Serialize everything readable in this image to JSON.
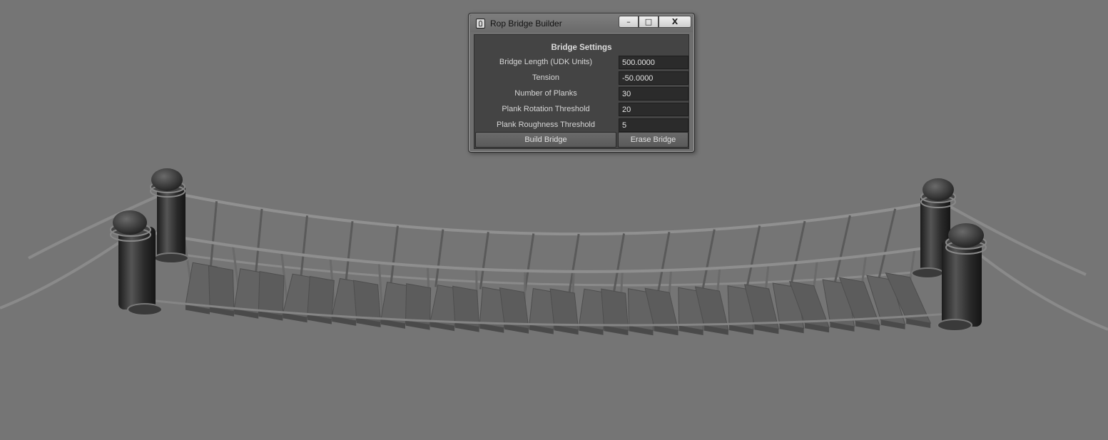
{
  "window": {
    "title": "Rop Bridge Builder",
    "controls": {
      "minimize": "–",
      "maximize": "□",
      "close": "X"
    }
  },
  "section": {
    "title": "Bridge Settings"
  },
  "fields": [
    {
      "label": "Bridge Length (UDK Units)",
      "value": "500.0000"
    },
    {
      "label": "Tension",
      "value": "-50.0000"
    },
    {
      "label": "Number of Planks",
      "value": "30"
    },
    {
      "label": "Plank Rotation Threshold",
      "value": "20"
    },
    {
      "label": "Plank Roughness Threshold",
      "value": "5"
    }
  ],
  "buttons": {
    "build": "Build Bridge",
    "erase": "Erase Bridge"
  },
  "colors": {
    "viewport_bg": "#757575",
    "panel_bg": "#444444",
    "field_bg": "#2b2b2b",
    "plank": "#5f5f5f",
    "post": "#2a2a2a",
    "rope": "#8c8c8c"
  }
}
